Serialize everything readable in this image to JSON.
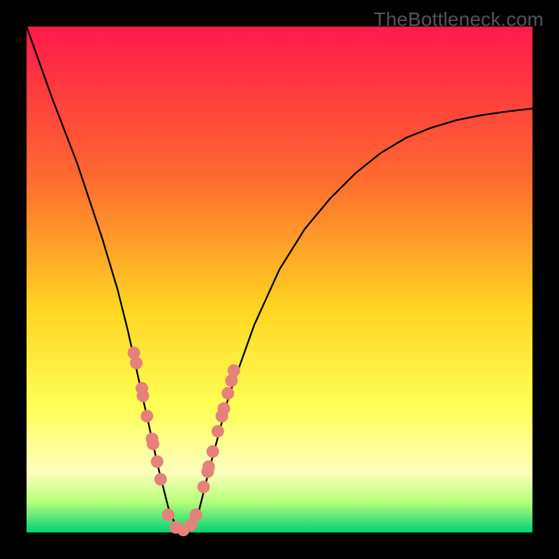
{
  "watermark": "TheBottleneck.com",
  "gradient": {
    "top": "#ff1a4b",
    "mid1": "#ff6a2f",
    "mid2": "#ffd622",
    "mid3": "#ffff55",
    "mid4": "#fdffbc",
    "bottom_band_top": "#b7ff7a",
    "bottom": "#00d074"
  },
  "curve": {
    "stroke": "#000000",
    "stroke_width": 2.4
  },
  "dots": {
    "fill": "#e58179",
    "radius": 9
  },
  "chart_data": {
    "type": "line",
    "title": "",
    "xlabel": "",
    "ylabel": "",
    "xlim": [
      0,
      1
    ],
    "ylim": [
      0,
      1
    ],
    "series": [
      {
        "name": "bottleneck-curve",
        "x": [
          0.0,
          0.05,
          0.1,
          0.15,
          0.18,
          0.2,
          0.22,
          0.24,
          0.26,
          0.28,
          0.3,
          0.32,
          0.34,
          0.36,
          0.4,
          0.45,
          0.5,
          0.55,
          0.6,
          0.65,
          0.7,
          0.75,
          0.8,
          0.85,
          0.9,
          0.95,
          1.0
        ],
        "y": [
          1.0,
          0.86,
          0.73,
          0.58,
          0.48,
          0.4,
          0.31,
          0.22,
          0.13,
          0.05,
          0.0,
          0.0,
          0.04,
          0.12,
          0.27,
          0.41,
          0.52,
          0.6,
          0.66,
          0.71,
          0.75,
          0.78,
          0.8,
          0.815,
          0.825,
          0.832,
          0.838
        ]
      }
    ],
    "highlight_points": {
      "left_branch": [
        {
          "x": 0.212,
          "y": 0.355
        },
        {
          "x": 0.217,
          "y": 0.335
        },
        {
          "x": 0.228,
          "y": 0.285
        },
        {
          "x": 0.23,
          "y": 0.27
        },
        {
          "x": 0.238,
          "y": 0.23
        },
        {
          "x": 0.248,
          "y": 0.185
        },
        {
          "x": 0.25,
          "y": 0.175
        },
        {
          "x": 0.258,
          "y": 0.14
        },
        {
          "x": 0.265,
          "y": 0.105
        }
      ],
      "valley": [
        {
          "x": 0.28,
          "y": 0.035
        },
        {
          "x": 0.295,
          "y": 0.01
        },
        {
          "x": 0.31,
          "y": 0.005
        },
        {
          "x": 0.325,
          "y": 0.015
        },
        {
          "x": 0.335,
          "y": 0.035
        }
      ],
      "right_branch": [
        {
          "x": 0.35,
          "y": 0.09
        },
        {
          "x": 0.358,
          "y": 0.12
        },
        {
          "x": 0.36,
          "y": 0.13
        },
        {
          "x": 0.368,
          "y": 0.16
        },
        {
          "x": 0.378,
          "y": 0.2
        },
        {
          "x": 0.386,
          "y": 0.23
        },
        {
          "x": 0.39,
          "y": 0.245
        },
        {
          "x": 0.398,
          "y": 0.275
        },
        {
          "x": 0.405,
          "y": 0.3
        },
        {
          "x": 0.41,
          "y": 0.32
        }
      ]
    }
  }
}
